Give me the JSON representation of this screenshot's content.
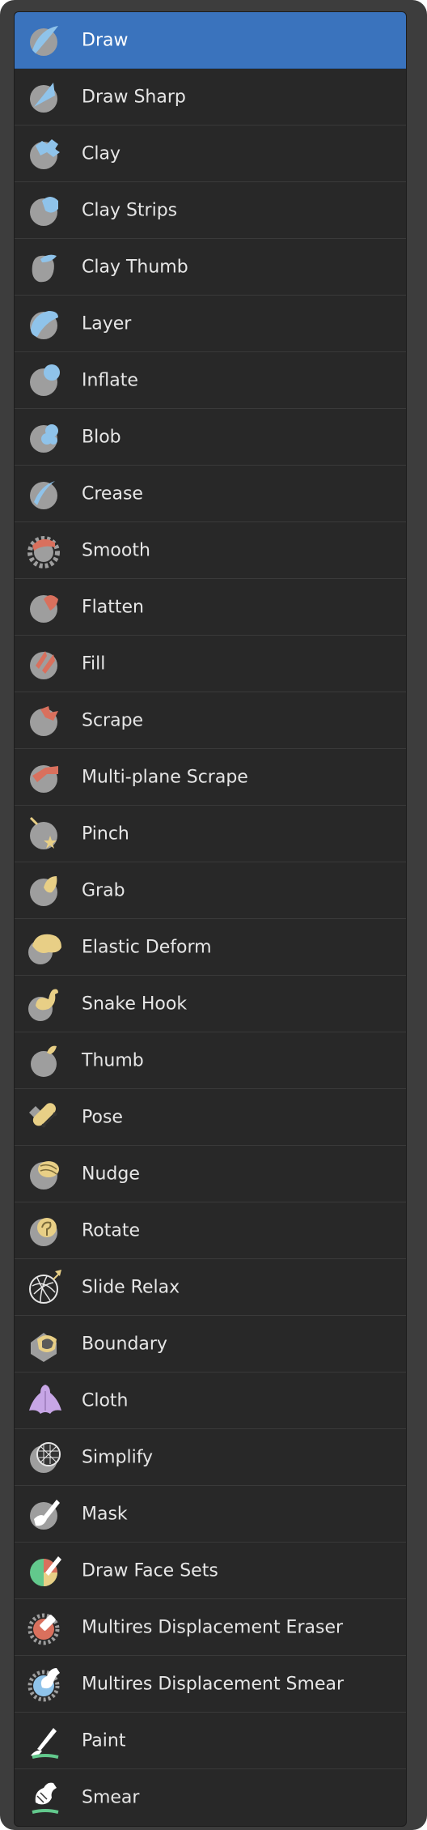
{
  "colors": {
    "panel_bg": "#3d3d3d",
    "list_bg": "#282828",
    "selected_bg": "#3a73bd",
    "text": "#e6e6e6",
    "icon_sphere": "#9e9e9e",
    "icon_blue": "#8fc3ea",
    "icon_red": "#d9705d",
    "icon_yellow": "#e8cf86",
    "icon_purple": "#c7a6e6",
    "icon_green": "#62c88c"
  },
  "brushes": [
    {
      "label": "Draw",
      "icon": "draw-icon",
      "selected": true
    },
    {
      "label": "Draw Sharp",
      "icon": "draw-sharp-icon"
    },
    {
      "label": "Clay",
      "icon": "clay-icon"
    },
    {
      "label": "Clay Strips",
      "icon": "clay-strips-icon"
    },
    {
      "label": "Clay Thumb",
      "icon": "clay-thumb-icon"
    },
    {
      "label": "Layer",
      "icon": "layer-icon"
    },
    {
      "label": "Inflate",
      "icon": "inflate-icon"
    },
    {
      "label": "Blob",
      "icon": "blob-icon"
    },
    {
      "label": "Crease",
      "icon": "crease-icon"
    },
    {
      "label": "Smooth",
      "icon": "smooth-icon"
    },
    {
      "label": "Flatten",
      "icon": "flatten-icon"
    },
    {
      "label": "Fill",
      "icon": "fill-icon"
    },
    {
      "label": "Scrape",
      "icon": "scrape-icon"
    },
    {
      "label": "Multi-plane Scrape",
      "icon": "multiplane-scrape-icon"
    },
    {
      "label": "Pinch",
      "icon": "pinch-icon"
    },
    {
      "label": "Grab",
      "icon": "grab-icon"
    },
    {
      "label": "Elastic Deform",
      "icon": "elastic-deform-icon"
    },
    {
      "label": "Snake Hook",
      "icon": "snake-hook-icon"
    },
    {
      "label": "Thumb",
      "icon": "thumb-icon"
    },
    {
      "label": "Pose",
      "icon": "pose-icon"
    },
    {
      "label": "Nudge",
      "icon": "nudge-icon"
    },
    {
      "label": "Rotate",
      "icon": "rotate-icon"
    },
    {
      "label": "Slide Relax",
      "icon": "slide-relax-icon"
    },
    {
      "label": "Boundary",
      "icon": "boundary-icon"
    },
    {
      "label": "Cloth",
      "icon": "cloth-icon"
    },
    {
      "label": "Simplify",
      "icon": "simplify-icon"
    },
    {
      "label": "Mask",
      "icon": "mask-icon"
    },
    {
      "label": "Draw Face Sets",
      "icon": "draw-face-sets-icon"
    },
    {
      "label": "Multires Displacement Eraser",
      "icon": "multires-eraser-icon"
    },
    {
      "label": "Multires Displacement Smear",
      "icon": "multires-smear-icon"
    },
    {
      "label": "Paint",
      "icon": "paint-icon"
    },
    {
      "label": "Smear",
      "icon": "smear-icon"
    }
  ]
}
